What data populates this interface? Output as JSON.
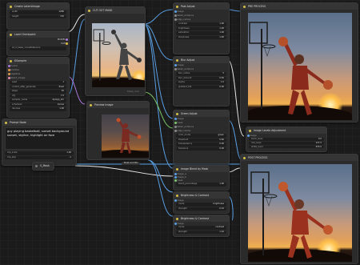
{
  "nodes": {
    "lora_loader": {
      "title": "Create LatentImage",
      "rows": [
        {
          "label": "width",
          "value": "1280"
        },
        {
          "label": "height",
          "value": "720"
        }
      ]
    },
    "load_checkpoint": {
      "title": "Load Checkpoint",
      "rows": [
        {
          "label": "MODEL",
          "value": ""
        },
        {
          "label": "CLIP",
          "value": ""
        }
      ],
      "widget": "sd_xl_base_1.0.safetensors"
    },
    "ksampler": {
      "title": "KSampler",
      "rows": [
        {
          "label": "model",
          "value": ""
        },
        {
          "label": "positive",
          "value": ""
        },
        {
          "label": "negative",
          "value": ""
        },
        {
          "label": "latent_image",
          "value": ""
        },
        {
          "label": "seed",
          "value": "1"
        },
        {
          "label": "control_after_generate",
          "value": "fixed"
        },
        {
          "label": "steps",
          "value": "20"
        },
        {
          "label": "cfg",
          "value": "7.0"
        },
        {
          "label": "sampler_name",
          "value": "dpmpp_2m"
        },
        {
          "label": "scheduler",
          "value": "karras"
        },
        {
          "label": "denoise",
          "value": "1.00"
        }
      ]
    },
    "prompt": {
      "title": "Prompt Node",
      "text": "guy playing basketball, sunset background\nsunset, skyline, highlight on face",
      "footer_rows": [
        {
          "label": "clip_scale",
          "value": "1.00"
        },
        {
          "label": "clip_skip",
          "value": "-1"
        }
      ]
    },
    "cutout": {
      "title": "CUT OUT MASK",
      "stat": "Mask_Out"
    },
    "preview": {
      "title": "Preview Image",
      "footer": "Mask and BG"
    },
    "post_adjust": {
      "title": "Post Adjust",
      "rows": [
        {
          "label": "image",
          "value": ""
        },
        {
          "label": "detail_enhance",
          "value": ""
        },
        {
          "label": "edge_radius",
          "value": ""
        },
        {
          "label": "contrast",
          "value": "1.00"
        },
        {
          "label": "brightness",
          "value": "1.00"
        },
        {
          "label": "saturation",
          "value": "1.00"
        },
        {
          "label": "sharpness",
          "value": "1.00"
        }
      ]
    },
    "blur_adjust": {
      "title": "Blur Adjust",
      "rows": [
        {
          "label": "image",
          "value": ""
        },
        {
          "label": "detail_enhance",
          "value": ""
        },
        {
          "label": "blur_radius",
          "value": "5"
        },
        {
          "label": "blur_amount",
          "value": "0.50"
        },
        {
          "label": "sigma",
          "value": "1.0"
        },
        {
          "label": "gradient_fall",
          "value": "0.00"
        }
      ]
    },
    "green_adjust": {
      "title": "Green Adjust",
      "rows": [
        {
          "label": "image",
          "value": ""
        },
        {
          "label": "mask",
          "value": ""
        },
        {
          "label": "detail_enhance",
          "value": ""
        },
        {
          "label": "edge_radius",
          "value": ""
        },
        {
          "label": "color_mode",
          "value": "green"
        },
        {
          "label": "threshold",
          "value": "0.60"
        },
        {
          "label": "transparency",
          "value": "0.00"
        },
        {
          "label": "tolerance",
          "value": "0.00"
        }
      ]
    },
    "image_blend": {
      "title": "Image Blend by Mask",
      "rows": [
        {
          "label": "image_a",
          "value": ""
        },
        {
          "label": "image_b",
          "value": ""
        },
        {
          "label": "mask",
          "value": ""
        },
        {
          "label": "blend_percentage",
          "value": "1.00"
        }
      ]
    },
    "brightness1": {
      "title": "Brightness & Contrast",
      "rows": [
        {
          "label": "image",
          "value": ""
        },
        {
          "label": "mode",
          "value": "brightness"
        },
        {
          "label": "strength",
          "value": "0.10"
        }
      ]
    },
    "brightness2": {
      "title": "Brightness & Contrast",
      "rows": [
        {
          "label": "image",
          "value": ""
        },
        {
          "label": "mode",
          "value": "contrast"
        },
        {
          "label": "strength",
          "value": "1.10"
        }
      ]
    },
    "levels": {
      "title": "Image Levels Adjustment",
      "rows": [
        {
          "label": "image",
          "value": ""
        },
        {
          "label": "black_level",
          "value": "0.0"
        },
        {
          "label": "mid_level",
          "value": "127.5"
        },
        {
          "label": "white_level",
          "value": "255.0"
        }
      ]
    },
    "pre_process": {
      "title": "PRE PROCESS"
    },
    "post_process": {
      "title": "POST PROCESS"
    },
    "small_node": {
      "title": "S_Mask"
    }
  },
  "colors": {
    "wire_blue": "#5aa0e6",
    "wire_white": "#e8e8e8",
    "wire_green": "#7bc86a",
    "wire_orange": "#e09a4a",
    "wire_purple": "#a878d8"
  }
}
